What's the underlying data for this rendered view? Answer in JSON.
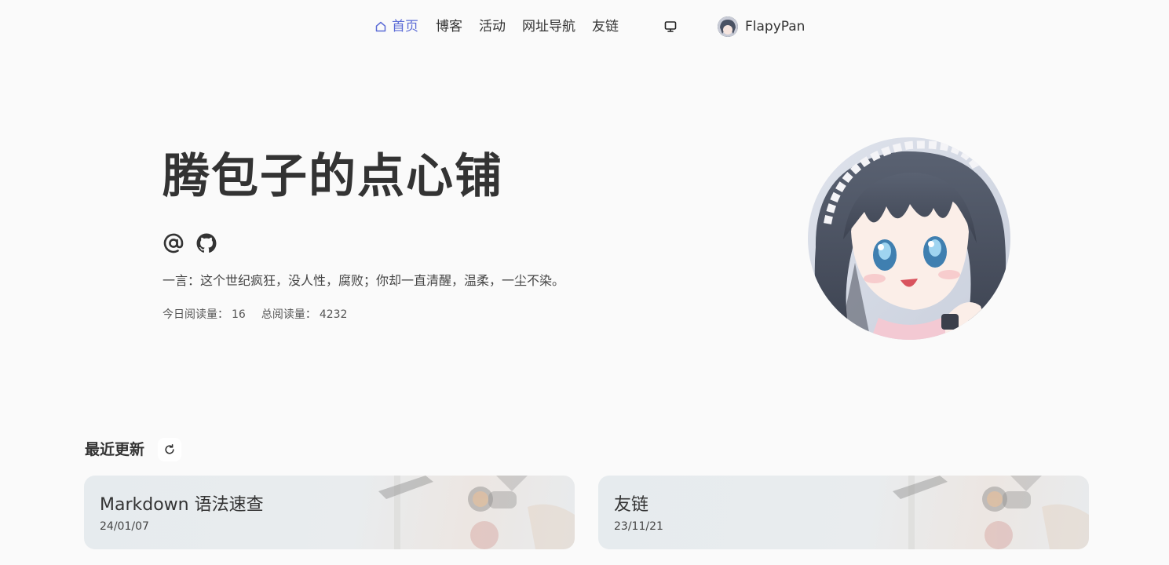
{
  "nav": {
    "home": "首页",
    "blog": "博客",
    "activity": "活动",
    "sites": "网址导航",
    "links": "友链",
    "username": "FlapyPan",
    "active_color": "#5b6bd6"
  },
  "hero": {
    "title": "腾包子的点心铺",
    "quote": "一言：这个世纪疯狂，没人性，腐败；你却一直清醒，温柔，一尘不染。",
    "stats": {
      "today_label": "今日阅读量：",
      "today_value": "16",
      "total_label": "总阅读量：",
      "total_value": "4232"
    }
  },
  "recent": {
    "title": "最近更新",
    "posts": [
      {
        "title": "Markdown 语法速查",
        "date": "24/01/07"
      },
      {
        "title": "友链",
        "date": "23/11/21"
      }
    ]
  },
  "icons": {
    "home": "home-icon",
    "monitor": "monitor-icon",
    "email": "at-sign-icon",
    "github": "github-icon",
    "refresh": "refresh-icon"
  }
}
